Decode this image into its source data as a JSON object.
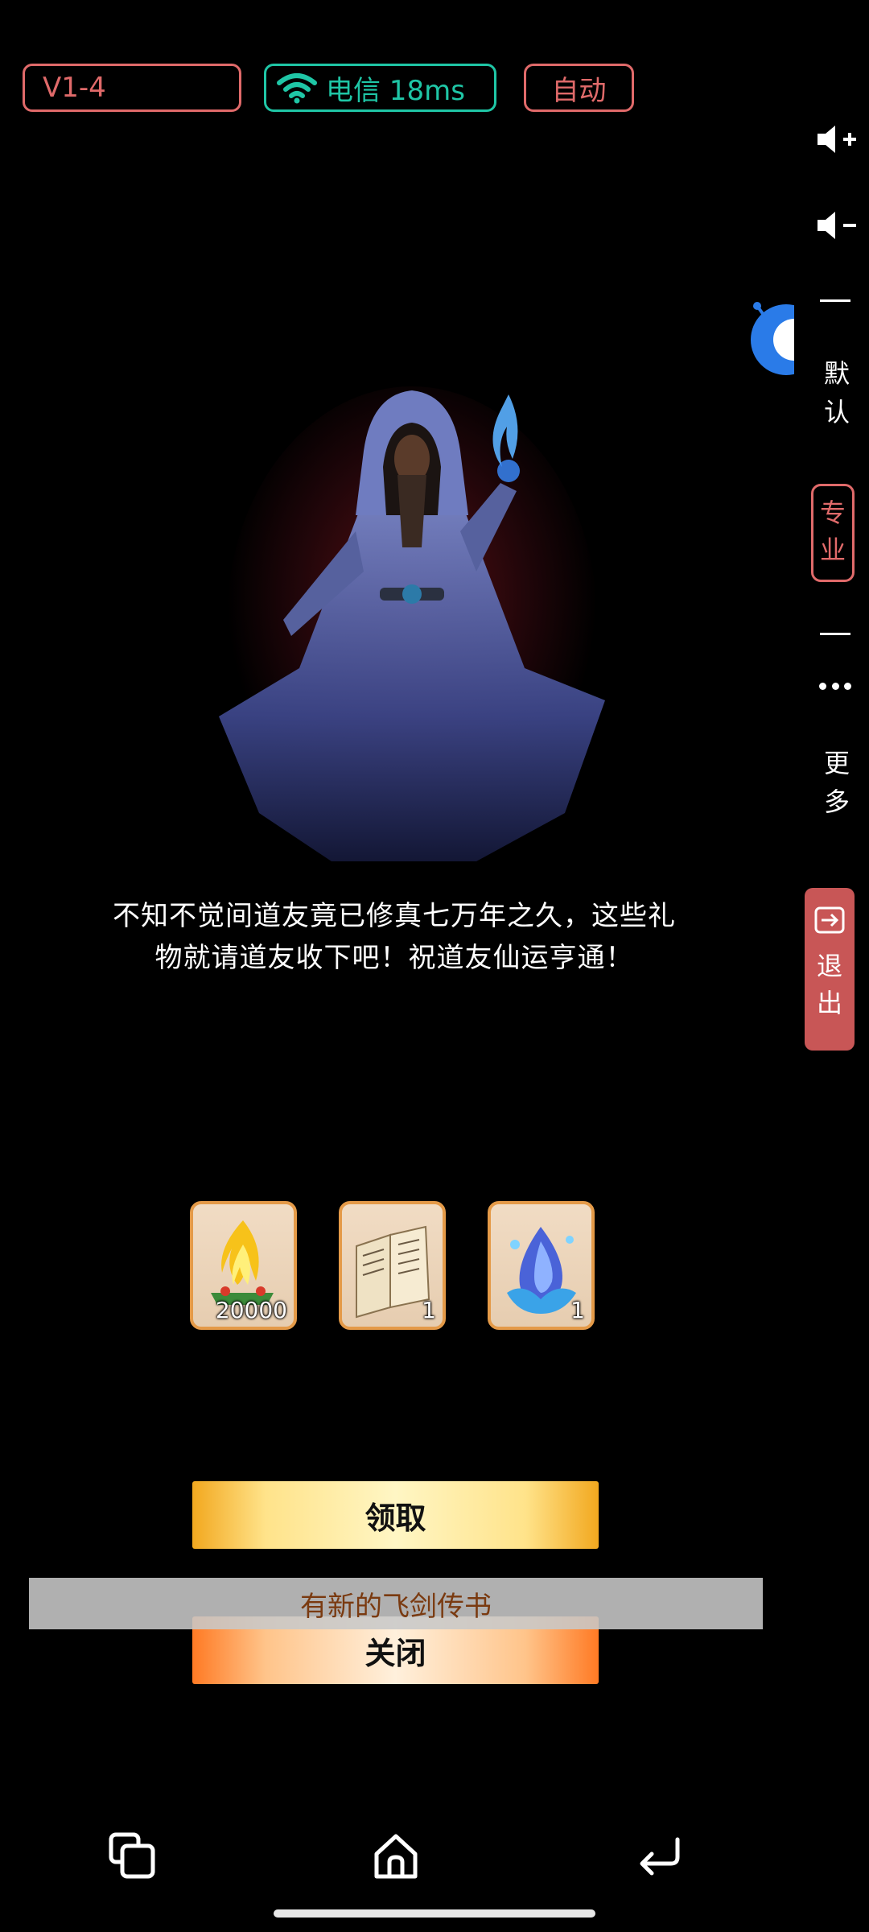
{
  "status_bar": {
    "version": "V1-4",
    "network": "电信 18ms",
    "auto": "自动"
  },
  "side_panel": {
    "default_label": "默\n认",
    "pro_label": "专\n业",
    "more_label": "更\n多",
    "exit_label": "退\n出"
  },
  "dialog": {
    "message": "不知不觉间道友竟已修真七万年之久，这些礼物就请道友收下吧！祝道友仙运亨通！"
  },
  "rewards": [
    {
      "icon": "flame-icon",
      "count": "20000"
    },
    {
      "icon": "book-icon",
      "count": "1"
    },
    {
      "icon": "water-orb-icon",
      "count": "1"
    }
  ],
  "buttons": {
    "claim": "领取",
    "close": "关闭"
  },
  "toast": {
    "message": "有新的飞剑传书"
  },
  "colors": {
    "accent_red": "#e06a6a",
    "accent_teal": "#1fc6a6",
    "item_border": "#e49a48",
    "exit_bg": "#c85656"
  }
}
